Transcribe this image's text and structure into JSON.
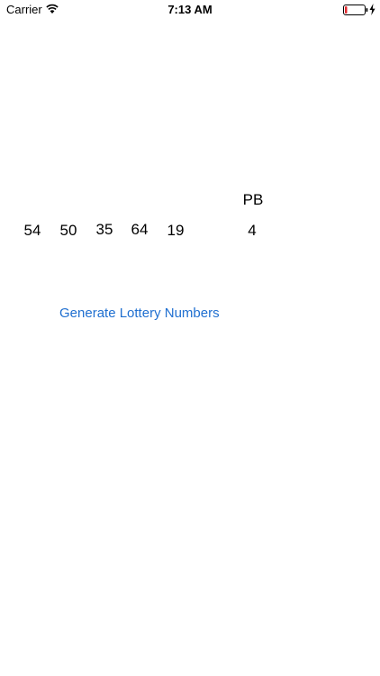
{
  "status_bar": {
    "carrier": "Carrier",
    "time": "7:13 AM",
    "battery_level": 0.12,
    "battery_color": "#e0282c",
    "icons": [
      "wifi-icon",
      "battery-icon",
      "charging-icon"
    ]
  },
  "lottery": {
    "numbers": [
      "54",
      "50",
      "35",
      "64",
      "19"
    ],
    "powerball_label": "PB",
    "powerball_number": "4"
  },
  "actions": {
    "generate_label": "Generate Lottery Numbers",
    "accent_color": "#1f6fd0"
  }
}
